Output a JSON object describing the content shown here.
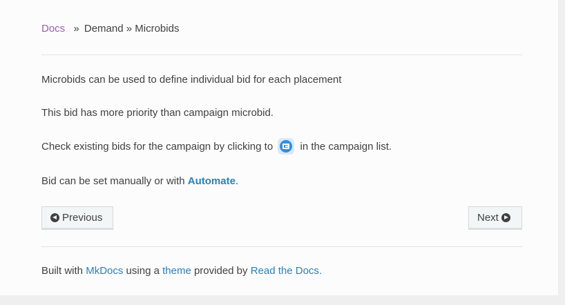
{
  "breadcrumbs": {
    "home": "Docs",
    "sep1": "»",
    "item1": "Demand",
    "sep2": "»",
    "item2": "Microbids"
  },
  "content": {
    "p1": "Microbids can be used to define individual bid for each placement",
    "p2": "This bid has more priority than campaign microbid.",
    "p3_before": "Check existing bids for the campaign by clicking to",
    "p3_icon": "campaign-bids-icon",
    "p3_after": "in the campaign list.",
    "p4_before": "Bid can be set manually or with",
    "p4_link": "Automate",
    "p4_after": "."
  },
  "nav": {
    "previous": "Previous",
    "next": "Next"
  },
  "footer": {
    "built_with": "Built with",
    "mkdocs": "MkDocs",
    "using_a": "using a",
    "theme": "theme",
    "provided_by": "provided by",
    "rtd": "Read the Docs",
    "period": "."
  },
  "colors": {
    "link": "#2980b9",
    "breadcrumb_link": "#9b59b6",
    "text": "#404040",
    "icon_blue": "#2f8fe8"
  }
}
